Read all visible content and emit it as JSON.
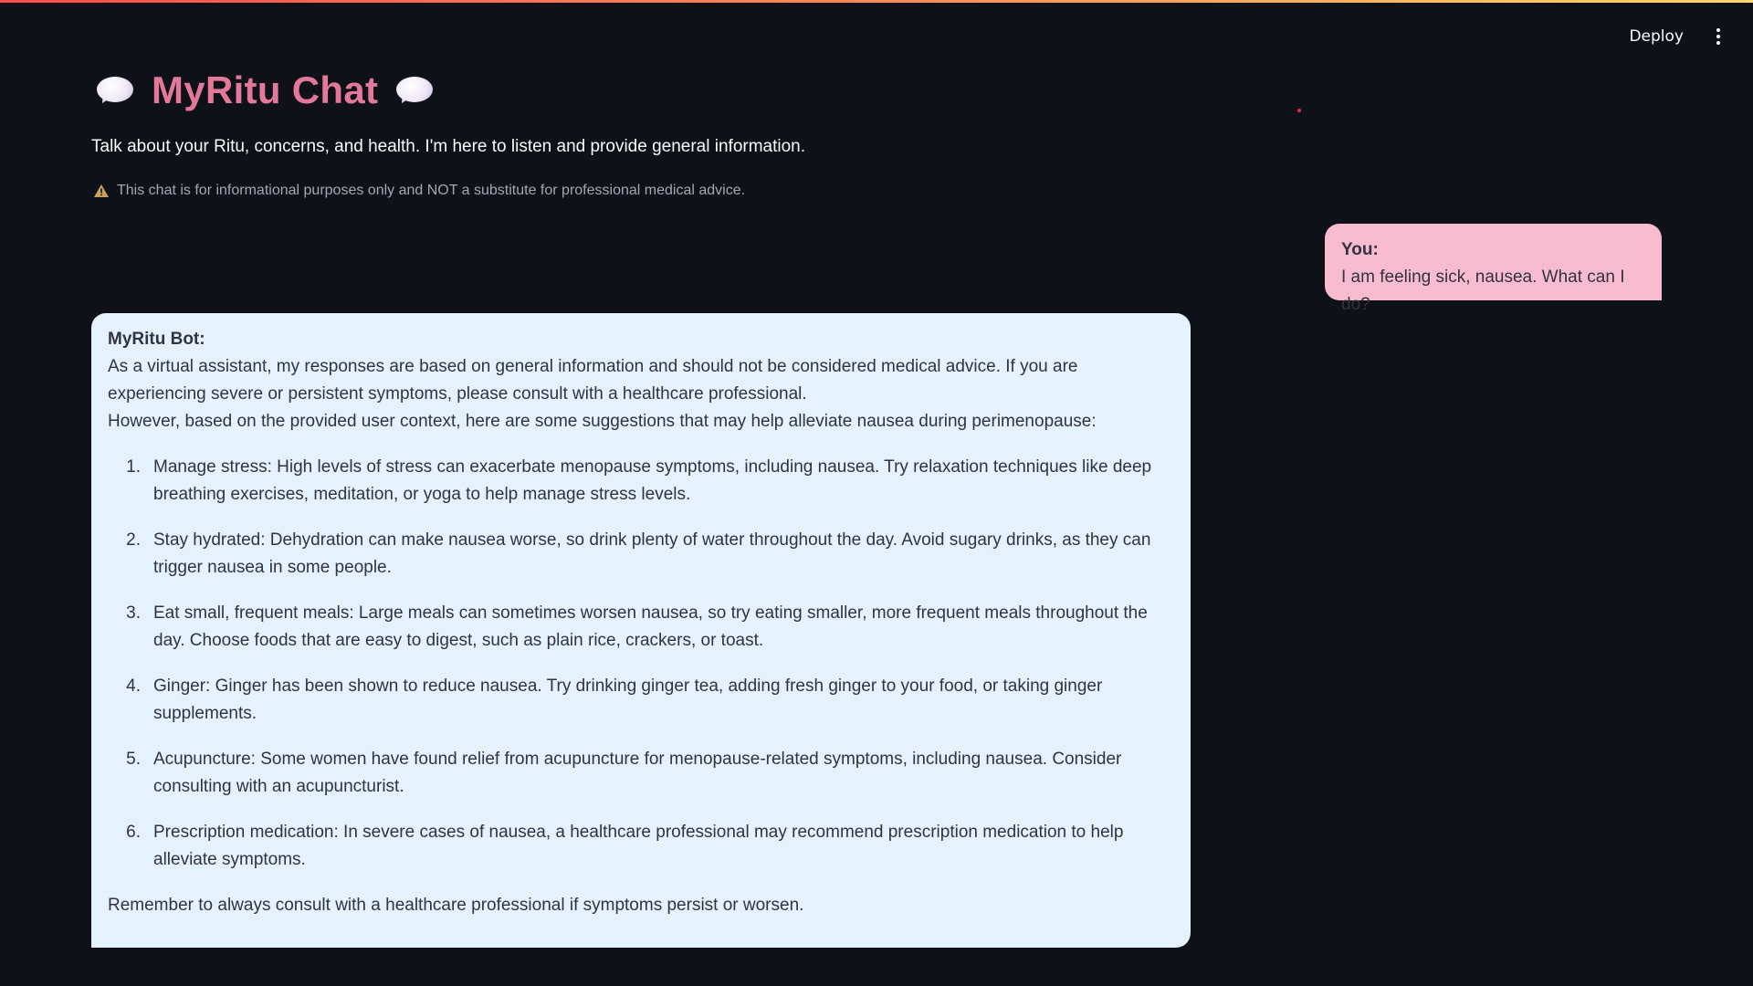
{
  "toolbar": {
    "deploy_label": "Deploy",
    "menu_icon": "more-vertical-icon"
  },
  "header": {
    "title": "MyRitu Chat",
    "left_icon": "speech-bubble-icon",
    "right_icon": "speech-bubble-icon",
    "title_color": "#e3789b",
    "subtitle": "Talk about your Ritu, concerns, and health. I'm here to listen and provide general information.",
    "disclaimer_icon": "warning-icon",
    "disclaimer": "This chat is for informational purposes only and NOT a substitute for professional medical advice."
  },
  "chat": {
    "user_message": {
      "speaker": "You:",
      "text": "I am feeling sick, nausea. What can I do?",
      "bubble_color": "#f8bbd0"
    },
    "bot_message": {
      "speaker": "MyRitu Bot:",
      "intro": "As a virtual assistant, my responses are based on general information and should not be considered medical advice. If you are experiencing severe or persistent symptoms, please consult with a healthcare professional.",
      "lead": "However, based on the provided user context, here are some suggestions that may help alleviate nausea during perimenopause:",
      "items": [
        {
          "num": "1.",
          "text": "Manage stress: High levels of stress can exacerbate menopause symptoms, including nausea. Try relaxation techniques like deep breathing exercises, meditation, or yoga to help manage stress levels."
        },
        {
          "num": "2.",
          "text": "Stay hydrated: Dehydration can make nausea worse, so drink plenty of water throughout the day. Avoid sugary drinks, as they can trigger nausea in some people."
        },
        {
          "num": "3.",
          "text": "Eat small, frequent meals: Large meals can sometimes worsen nausea, so try eating smaller, more frequent meals throughout the day. Choose foods that are easy to digest, such as plain rice, crackers, or toast."
        },
        {
          "num": "4.",
          "text": "Ginger: Ginger has been shown to reduce nausea. Try drinking ginger tea, adding fresh ginger to your food, or taking ginger supplements."
        },
        {
          "num": "5.",
          "text": "Acupuncture: Some women have found relief from acupuncture for menopause-related symptoms, including nausea. Consider consulting with an acupuncturist."
        },
        {
          "num": "6.",
          "text": "Prescription medication: In severe cases of nausea, a healthcare professional may recommend prescription medication to help alleviate symptoms."
        }
      ],
      "closing": "Remember to always consult with a healthcare professional if symptoms persist or worsen.",
      "bubble_color": "#e3f2fd"
    }
  },
  "theme": {
    "background": "#0e1117",
    "top_gradient": [
      "#ff4b4b",
      "#fdd663"
    ]
  }
}
